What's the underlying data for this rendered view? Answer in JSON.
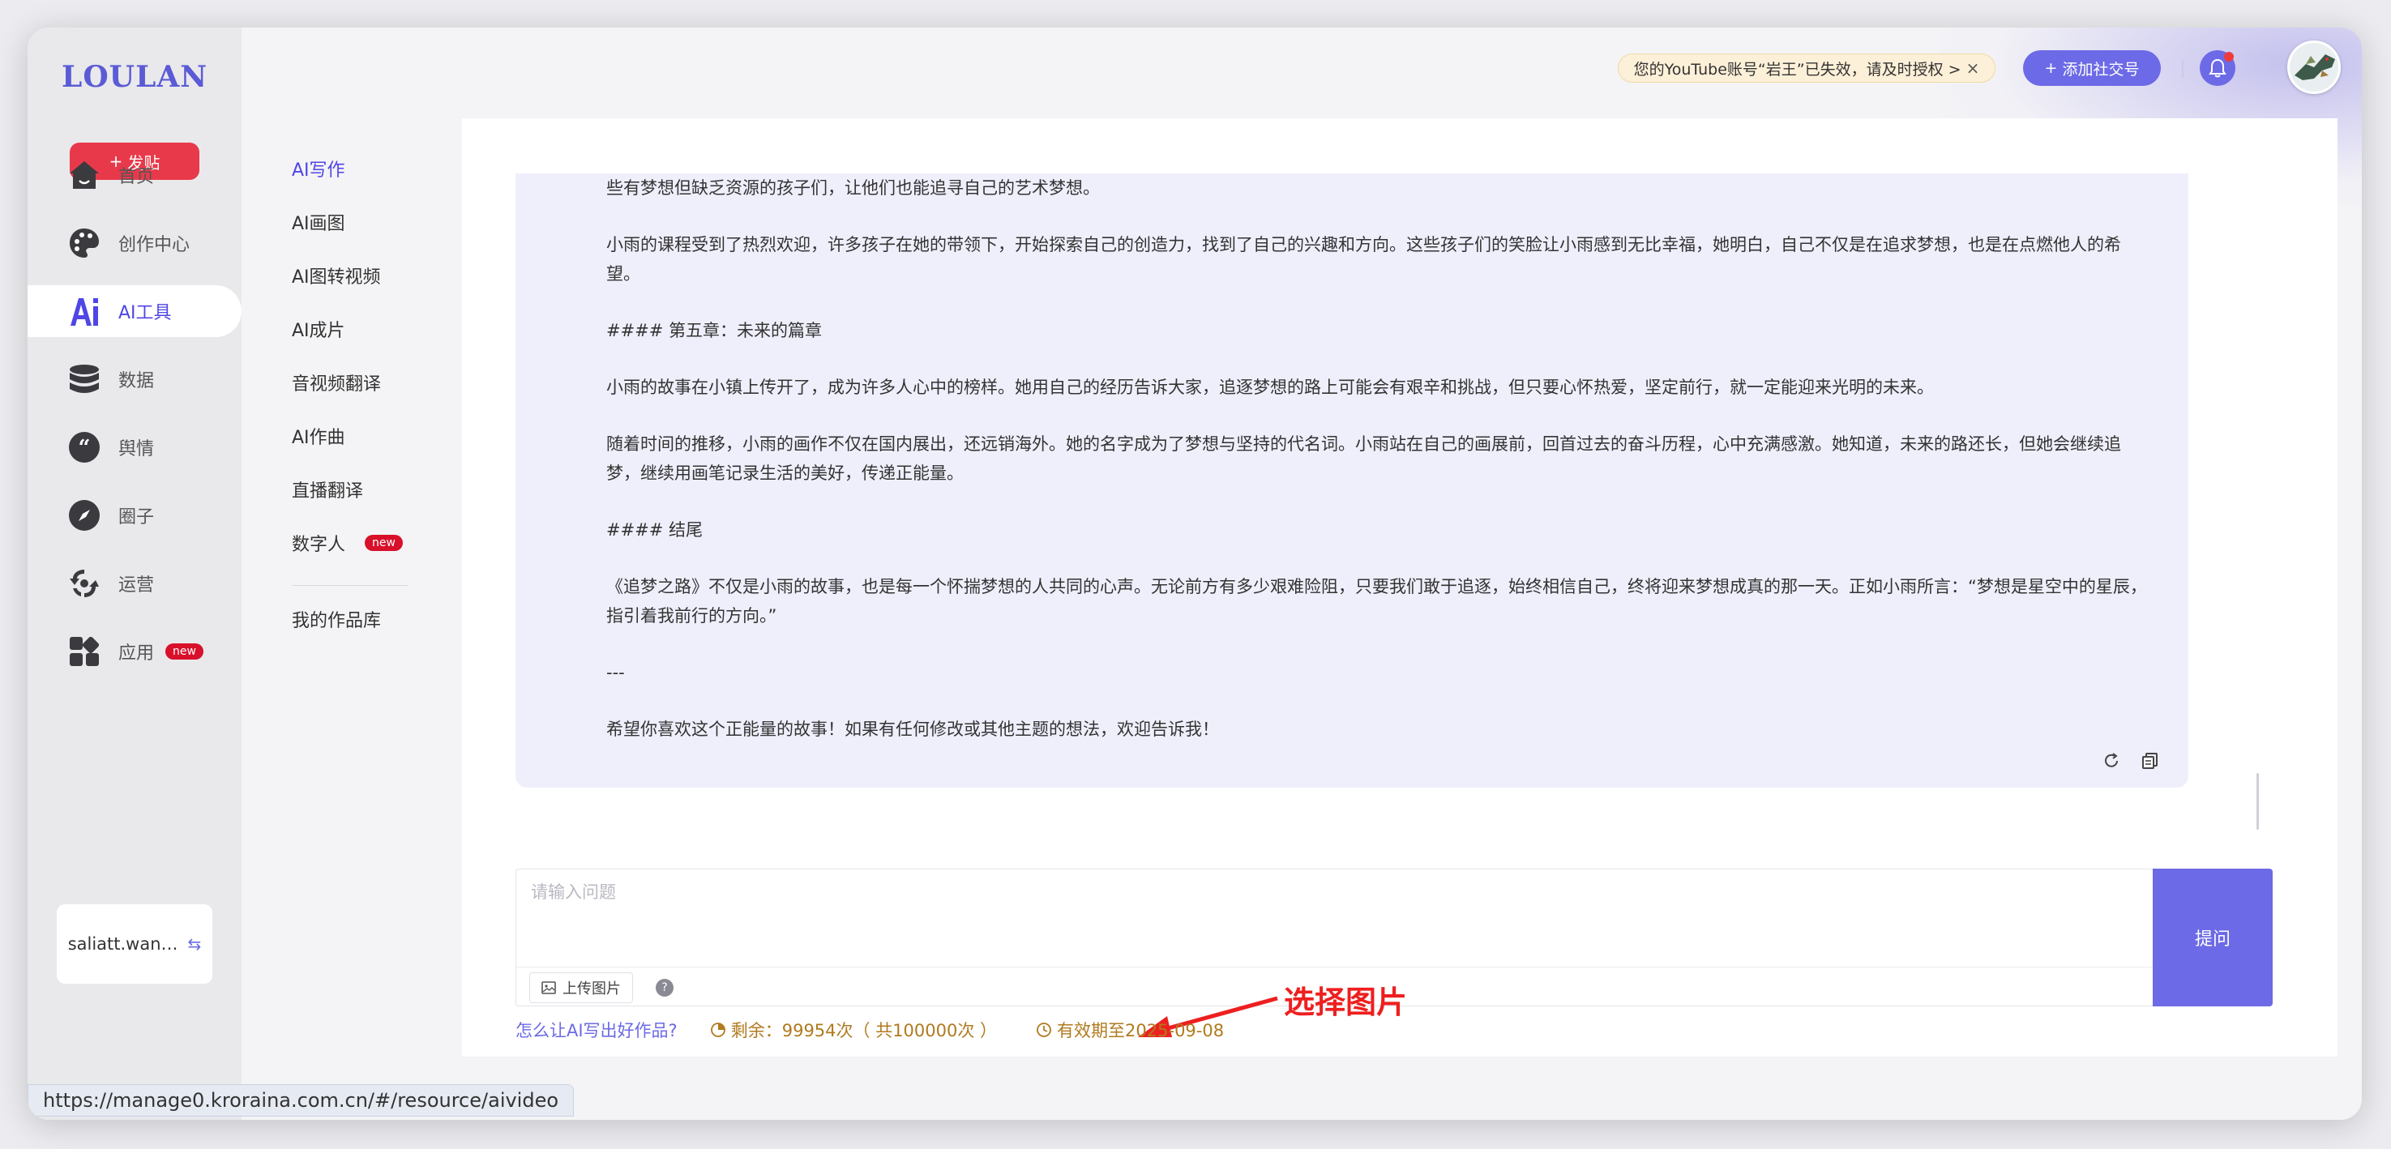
{
  "brand": {
    "logo": "LOULAN",
    "post_label": "发贴"
  },
  "nav": [
    {
      "label": "首页",
      "icon": "home-icon",
      "active": false,
      "badge": ""
    },
    {
      "label": "创作中心",
      "icon": "palette-icon",
      "active": false,
      "badge": ""
    },
    {
      "label": "AI工具",
      "icon": "ai-icon",
      "active": true,
      "badge": ""
    },
    {
      "label": "数据",
      "icon": "database-icon",
      "active": false,
      "badge": ""
    },
    {
      "label": "舆情",
      "icon": "quote-icon",
      "active": false,
      "badge": ""
    },
    {
      "label": "圈子",
      "icon": "compass-icon",
      "active": false,
      "badge": ""
    },
    {
      "label": "运营",
      "icon": "operations-icon",
      "active": false,
      "badge": ""
    },
    {
      "label": "应用",
      "icon": "apps-icon",
      "active": false,
      "badge": "new"
    }
  ],
  "user": {
    "name": "saliatt.wan…"
  },
  "subnav": [
    {
      "label": "AI写作",
      "active": true,
      "badge": ""
    },
    {
      "label": "AI画图",
      "active": false,
      "badge": ""
    },
    {
      "label": "AI图转视频",
      "active": false,
      "badge": ""
    },
    {
      "label": "AI成片",
      "active": false,
      "badge": ""
    },
    {
      "label": "音视频翻译",
      "active": false,
      "badge": ""
    },
    {
      "label": "AI作曲",
      "active": false,
      "badge": ""
    },
    {
      "label": "直播翻译",
      "active": false,
      "badge": ""
    },
    {
      "label": "数字人",
      "active": false,
      "badge": "new"
    },
    {
      "label": "我的作品库",
      "active": false,
      "badge": ""
    }
  ],
  "topbar": {
    "notice": "您的YouTube账号“岩王”已失效，请及时授权 >",
    "notice_close": "×",
    "add_social": "添加社交号"
  },
  "chat": {
    "paragraphs": [
      "些有梦想但缺乏资源的孩子们，让他们也能追寻自己的艺术梦想。",
      "小雨的课程受到了热烈欢迎，许多孩子在她的带领下，开始探索自己的创造力，找到了自己的兴趣和方向。这些孩子们的笑脸让小雨感到无比幸福，她明白，自己不仅是在追求梦想，也是在点燃他人的希望。",
      "#### 第五章：未来的篇章",
      "小雨的故事在小镇上传开了，成为许多人心中的榜样。她用自己的经历告诉大家，追逐梦想的路上可能会有艰辛和挑战，但只要心怀热爱，坚定前行，就一定能迎来光明的未来。",
      "随着时间的推移，小雨的画作不仅在国内展出，还远销海外。她的名字成为了梦想与坚持的代名词。小雨站在自己的画展前，回首过去的奋斗历程，心中充满感激。她知道，未来的路还长，但她会继续追梦，继续用画笔记录生活的美好，传递正能量。",
      "#### 结尾",
      "《追梦之路》不仅是小雨的故事，也是每一个怀揣梦想的人共同的心声。无论前方有多少艰难险阻，只要我们敢于追逐，始终相信自己，终将迎来梦想成真的那一天。正如小雨所言：“梦想是星空中的星辰，指引着我前行的方向。”",
      "---",
      "希望你喜欢这个正能量的故事！如果有任何修改或其他主题的想法，欢迎告诉我！"
    ]
  },
  "input": {
    "placeholder": "请输入问题",
    "upload_label": "上传图片",
    "help": "?",
    "submit_label": "提问"
  },
  "annotation": {
    "text": "选择图片",
    "color": "#ee1f1f"
  },
  "info": {
    "tip_link": "怎么让AI写出好作品?",
    "remaining": "剩余：99954次（ 共100000次 ）",
    "valid_until": "有效期至2025-09-08"
  },
  "status_url": "https://manage0.kroraina.com.cn/#/resource/aivideo",
  "colors": {
    "accent": "#6c6ae6",
    "danger": "#e8394a",
    "notice_bg": "#fdf0d8",
    "warning_text": "#b07a1e"
  }
}
